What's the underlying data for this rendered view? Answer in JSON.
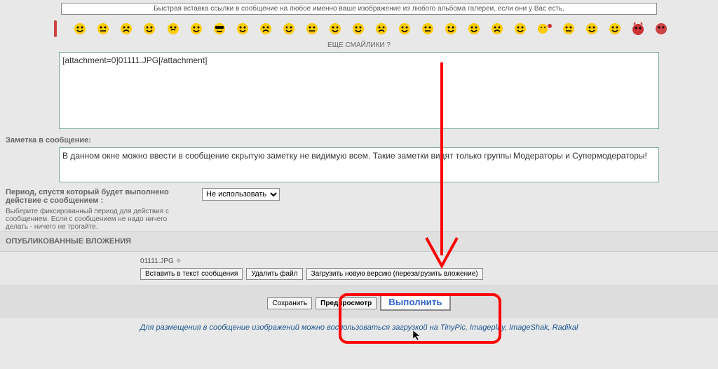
{
  "header": {
    "quickInsert": "Быстрая вставка ссылки в сообщение на любое именно ваше изображение из любого альбома галереи, если они у Вас есть."
  },
  "emoji": {
    "moreLabel": "ЕЩЕ СМАЙЛИКИ ?"
  },
  "editor": {
    "content": "[attachment=0]01111.JPG[/attachment]"
  },
  "note": {
    "label": "Заметка в сообщение:",
    "content": "В данном окне можно ввести в сообщение скрытую заметку не видимую всем. Такие заметки видят только группы Модераторы и Супермодераторы!"
  },
  "period": {
    "label": "Период, спустя который будет выполнено действие с сообщением :",
    "desc": "Выберите фиксированный период для действия с сообщением. Если с сообщением не надо ничего делать - ничего не трогайте.",
    "selected": "Не использовать"
  },
  "attachments": {
    "header": "ОПУБЛИКОВАННЫЕ ВЛОЖЕНИЯ",
    "filename": "01111.JPG ✧",
    "insertBtn": "Вставить в текст сообщения",
    "deleteBtn": "Удалить файл",
    "reloadBtn": "Загрузить новую версию (перезагрузить вложение)"
  },
  "buttons": {
    "save": "Сохранить",
    "preview": "Предпросмотр",
    "execute": "Выполнить"
  },
  "footer": {
    "text": "Для размещения в сообщение изображений можно воспользоваться загрузкой на TinyPic, Imageplay, ImageShak, Radikal"
  }
}
